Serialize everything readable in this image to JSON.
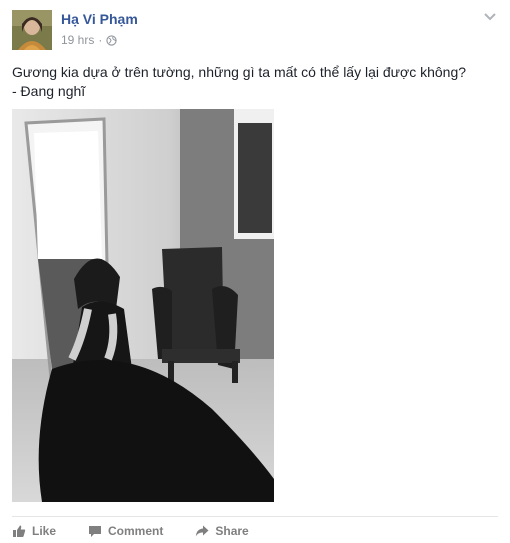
{
  "post": {
    "author_name": "Hạ Vi Phạm",
    "timestamp": "19 hrs",
    "separator": "·",
    "privacy_icon": "globe-icon",
    "menu_icon": "chevron-down-icon",
    "caption_lines": [
      "Gương kia dựa ở trên tường, những gì ta mất có thể lấy lại được không?",
      "- Đang nghĩ"
    ],
    "photo_subject": "black-and-white photo"
  },
  "actions": {
    "like_label": "Like",
    "comment_label": "Comment",
    "share_label": "Share"
  },
  "colors": {
    "author_link": "#365899",
    "meta_gray": "#90949c",
    "action_gray": "#7f7f7f",
    "divider": "#e5e5e5"
  }
}
